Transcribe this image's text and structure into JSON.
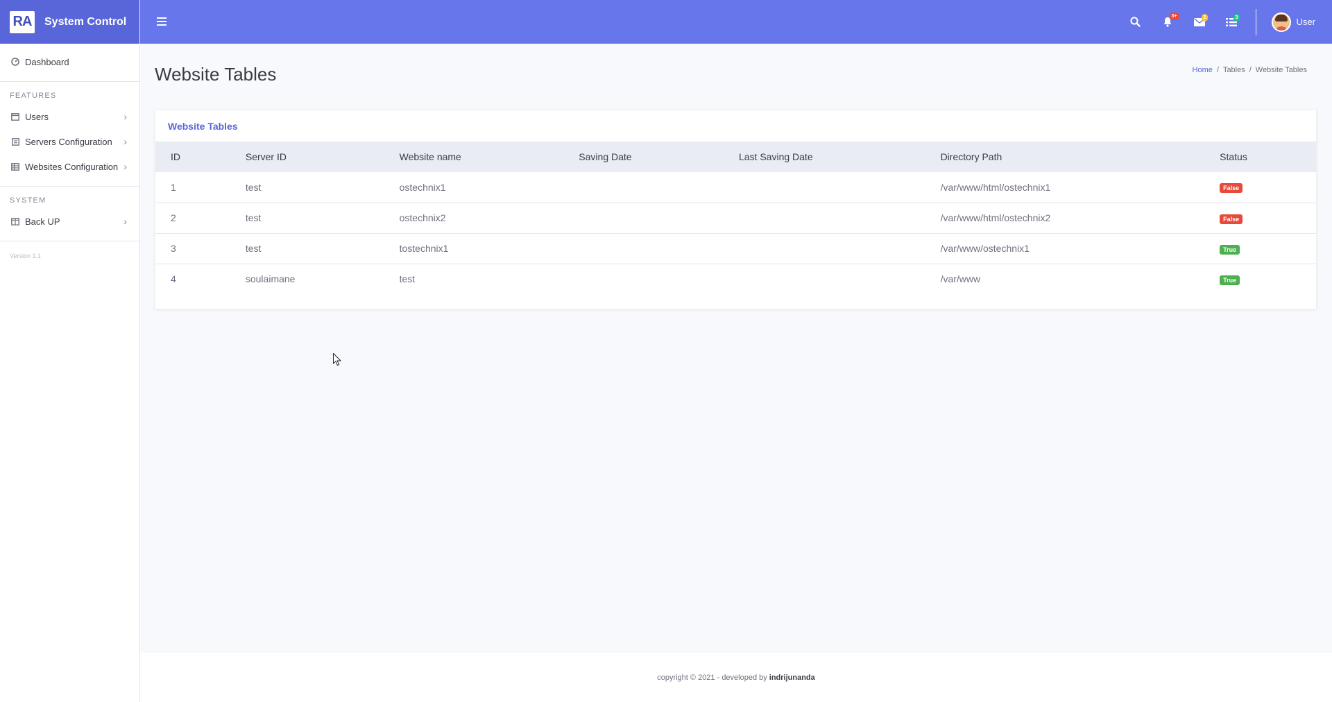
{
  "brand": {
    "logo_text": "RA",
    "title": "System Control"
  },
  "sidebar": {
    "dashboard": "Dashboard",
    "features_heading": "FEATURES",
    "features": [
      {
        "label": "Users",
        "icon": "window-icon"
      },
      {
        "label": "Servers Configuration",
        "icon": "server-icon"
      },
      {
        "label": "Websites Configuration",
        "icon": "table-icon"
      }
    ],
    "system_heading": "SYSTEM",
    "system": [
      {
        "label": "Back UP",
        "icon": "columns-icon"
      }
    ],
    "version": "Version 1.1"
  },
  "topbar": {
    "notifications_badge": "3+",
    "messages_badge": "2",
    "tasks_badge": "3",
    "user_name": "User"
  },
  "page": {
    "title": "Website Tables",
    "breadcrumb": [
      "Home",
      "Tables",
      "Website Tables"
    ]
  },
  "card": {
    "title": "Website Tables",
    "columns": [
      "ID",
      "Server ID",
      "Website name",
      "Saving Date",
      "Last Saving Date",
      "Directory Path",
      "Status"
    ],
    "rows": [
      {
        "id": "1",
        "server_id": "test",
        "website_name": "ostechnix1",
        "saving_date": "",
        "last_saving_date": "",
        "directory_path": "/var/www/html/ostechnix1",
        "status": "False"
      },
      {
        "id": "2",
        "server_id": "test",
        "website_name": "ostechnix2",
        "saving_date": "",
        "last_saving_date": "",
        "directory_path": "/var/www/html/ostechnix2",
        "status": "False"
      },
      {
        "id": "3",
        "server_id": "test",
        "website_name": "tostechnix1",
        "saving_date": "",
        "last_saving_date": "",
        "directory_path": "/var/www/ostechnix1",
        "status": "True"
      },
      {
        "id": "4",
        "server_id": "soulaimane",
        "website_name": "test",
        "saving_date": "",
        "last_saving_date": "",
        "directory_path": "/var/www",
        "status": "True"
      }
    ]
  },
  "footer": {
    "text": "copyright © 2021 - developed by",
    "author": "indrijunanda"
  },
  "colors": {
    "primary": "#6776eb",
    "brand_bg": "#5866d9",
    "false_badge": "#e74a3b",
    "true_badge": "#4caf50",
    "notif_badge": "#e74a3b",
    "msg_badge": "#f6c23e",
    "task_badge": "#1cc88a"
  }
}
